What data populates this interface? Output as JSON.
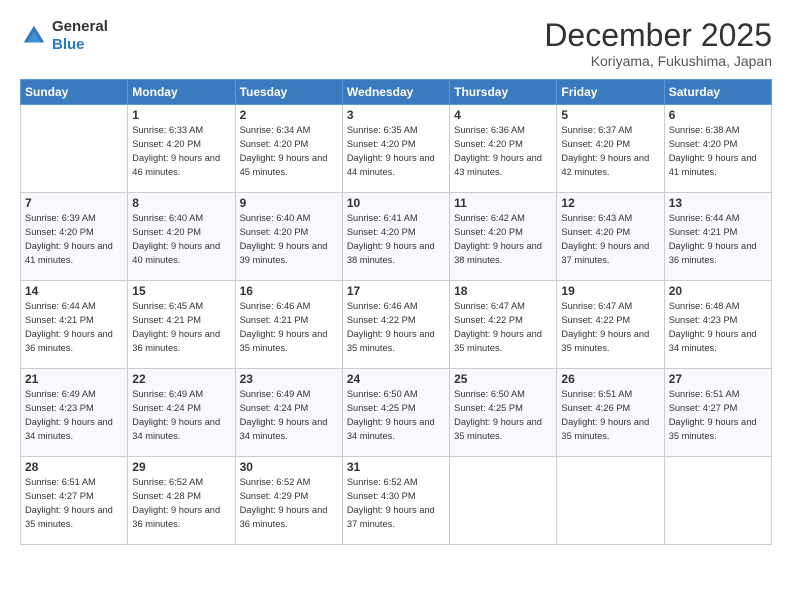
{
  "logo": {
    "general": "General",
    "blue": "Blue"
  },
  "header": {
    "title": "December 2025",
    "subtitle": "Koriyama, Fukushima, Japan"
  },
  "weekdays": [
    "Sunday",
    "Monday",
    "Tuesday",
    "Wednesday",
    "Thursday",
    "Friday",
    "Saturday"
  ],
  "weeks": [
    [
      {
        "day": "",
        "sunrise": "",
        "sunset": "",
        "daylight": ""
      },
      {
        "day": "1",
        "sunrise": "Sunrise: 6:33 AM",
        "sunset": "Sunset: 4:20 PM",
        "daylight": "Daylight: 9 hours and 46 minutes."
      },
      {
        "day": "2",
        "sunrise": "Sunrise: 6:34 AM",
        "sunset": "Sunset: 4:20 PM",
        "daylight": "Daylight: 9 hours and 45 minutes."
      },
      {
        "day": "3",
        "sunrise": "Sunrise: 6:35 AM",
        "sunset": "Sunset: 4:20 PM",
        "daylight": "Daylight: 9 hours and 44 minutes."
      },
      {
        "day": "4",
        "sunrise": "Sunrise: 6:36 AM",
        "sunset": "Sunset: 4:20 PM",
        "daylight": "Daylight: 9 hours and 43 minutes."
      },
      {
        "day": "5",
        "sunrise": "Sunrise: 6:37 AM",
        "sunset": "Sunset: 4:20 PM",
        "daylight": "Daylight: 9 hours and 42 minutes."
      },
      {
        "day": "6",
        "sunrise": "Sunrise: 6:38 AM",
        "sunset": "Sunset: 4:20 PM",
        "daylight": "Daylight: 9 hours and 41 minutes."
      }
    ],
    [
      {
        "day": "7",
        "sunrise": "Sunrise: 6:39 AM",
        "sunset": "Sunset: 4:20 PM",
        "daylight": "Daylight: 9 hours and 41 minutes."
      },
      {
        "day": "8",
        "sunrise": "Sunrise: 6:40 AM",
        "sunset": "Sunset: 4:20 PM",
        "daylight": "Daylight: 9 hours and 40 minutes."
      },
      {
        "day": "9",
        "sunrise": "Sunrise: 6:40 AM",
        "sunset": "Sunset: 4:20 PM",
        "daylight": "Daylight: 9 hours and 39 minutes."
      },
      {
        "day": "10",
        "sunrise": "Sunrise: 6:41 AM",
        "sunset": "Sunset: 4:20 PM",
        "daylight": "Daylight: 9 hours and 38 minutes."
      },
      {
        "day": "11",
        "sunrise": "Sunrise: 6:42 AM",
        "sunset": "Sunset: 4:20 PM",
        "daylight": "Daylight: 9 hours and 38 minutes."
      },
      {
        "day": "12",
        "sunrise": "Sunrise: 6:43 AM",
        "sunset": "Sunset: 4:20 PM",
        "daylight": "Daylight: 9 hours and 37 minutes."
      },
      {
        "day": "13",
        "sunrise": "Sunrise: 6:44 AM",
        "sunset": "Sunset: 4:21 PM",
        "daylight": "Daylight: 9 hours and 36 minutes."
      }
    ],
    [
      {
        "day": "14",
        "sunrise": "Sunrise: 6:44 AM",
        "sunset": "Sunset: 4:21 PM",
        "daylight": "Daylight: 9 hours and 36 minutes."
      },
      {
        "day": "15",
        "sunrise": "Sunrise: 6:45 AM",
        "sunset": "Sunset: 4:21 PM",
        "daylight": "Daylight: 9 hours and 36 minutes."
      },
      {
        "day": "16",
        "sunrise": "Sunrise: 6:46 AM",
        "sunset": "Sunset: 4:21 PM",
        "daylight": "Daylight: 9 hours and 35 minutes."
      },
      {
        "day": "17",
        "sunrise": "Sunrise: 6:46 AM",
        "sunset": "Sunset: 4:22 PM",
        "daylight": "Daylight: 9 hours and 35 minutes."
      },
      {
        "day": "18",
        "sunrise": "Sunrise: 6:47 AM",
        "sunset": "Sunset: 4:22 PM",
        "daylight": "Daylight: 9 hours and 35 minutes."
      },
      {
        "day": "19",
        "sunrise": "Sunrise: 6:47 AM",
        "sunset": "Sunset: 4:22 PM",
        "daylight": "Daylight: 9 hours and 35 minutes."
      },
      {
        "day": "20",
        "sunrise": "Sunrise: 6:48 AM",
        "sunset": "Sunset: 4:23 PM",
        "daylight": "Daylight: 9 hours and 34 minutes."
      }
    ],
    [
      {
        "day": "21",
        "sunrise": "Sunrise: 6:49 AM",
        "sunset": "Sunset: 4:23 PM",
        "daylight": "Daylight: 9 hours and 34 minutes."
      },
      {
        "day": "22",
        "sunrise": "Sunrise: 6:49 AM",
        "sunset": "Sunset: 4:24 PM",
        "daylight": "Daylight: 9 hours and 34 minutes."
      },
      {
        "day": "23",
        "sunrise": "Sunrise: 6:49 AM",
        "sunset": "Sunset: 4:24 PM",
        "daylight": "Daylight: 9 hours and 34 minutes."
      },
      {
        "day": "24",
        "sunrise": "Sunrise: 6:50 AM",
        "sunset": "Sunset: 4:25 PM",
        "daylight": "Daylight: 9 hours and 34 minutes."
      },
      {
        "day": "25",
        "sunrise": "Sunrise: 6:50 AM",
        "sunset": "Sunset: 4:25 PM",
        "daylight": "Daylight: 9 hours and 35 minutes."
      },
      {
        "day": "26",
        "sunrise": "Sunrise: 6:51 AM",
        "sunset": "Sunset: 4:26 PM",
        "daylight": "Daylight: 9 hours and 35 minutes."
      },
      {
        "day": "27",
        "sunrise": "Sunrise: 6:51 AM",
        "sunset": "Sunset: 4:27 PM",
        "daylight": "Daylight: 9 hours and 35 minutes."
      }
    ],
    [
      {
        "day": "28",
        "sunrise": "Sunrise: 6:51 AM",
        "sunset": "Sunset: 4:27 PM",
        "daylight": "Daylight: 9 hours and 35 minutes."
      },
      {
        "day": "29",
        "sunrise": "Sunrise: 6:52 AM",
        "sunset": "Sunset: 4:28 PM",
        "daylight": "Daylight: 9 hours and 36 minutes."
      },
      {
        "day": "30",
        "sunrise": "Sunrise: 6:52 AM",
        "sunset": "Sunset: 4:29 PM",
        "daylight": "Daylight: 9 hours and 36 minutes."
      },
      {
        "day": "31",
        "sunrise": "Sunrise: 6:52 AM",
        "sunset": "Sunset: 4:30 PM",
        "daylight": "Daylight: 9 hours and 37 minutes."
      },
      {
        "day": "",
        "sunrise": "",
        "sunset": "",
        "daylight": ""
      },
      {
        "day": "",
        "sunrise": "",
        "sunset": "",
        "daylight": ""
      },
      {
        "day": "",
        "sunrise": "",
        "sunset": "",
        "daylight": ""
      }
    ]
  ]
}
